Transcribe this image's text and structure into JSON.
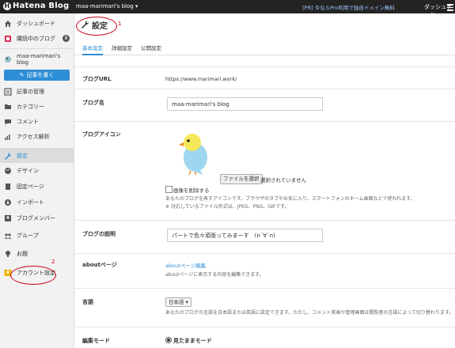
{
  "topbar": {
    "logo_text": "Hatena Blog",
    "blog_selector": "maa-marimari's blog ▾",
    "promo": "[PR] 今ならPro利用で独自ドメイン無料",
    "dashboard": "ダッシュボード"
  },
  "sidebar": {
    "items": [
      {
        "label": "ダッシュボード",
        "icon": "home-icon"
      },
      {
        "label": "購読中のブログ",
        "icon": "rss-icon",
        "badge": "8"
      },
      {
        "label": "maa-marimari's blog",
        "icon": "blog-icon"
      },
      {
        "label": "記事の管理",
        "icon": "list-icon"
      },
      {
        "label": "カテゴリー",
        "icon": "folder-icon"
      },
      {
        "label": "コメント",
        "icon": "comment-icon"
      },
      {
        "label": "アクセス解析",
        "icon": "chart-icon"
      },
      {
        "label": "設定",
        "icon": "wrench-icon"
      },
      {
        "label": "デザイン",
        "icon": "palette-icon"
      },
      {
        "label": "固定ページ",
        "icon": "page-icon"
      },
      {
        "label": "インポート",
        "icon": "import-icon"
      },
      {
        "label": "ブログメンバー",
        "icon": "members-icon"
      },
      {
        "label": "グループ",
        "icon": "group-icon"
      },
      {
        "label": "お題",
        "icon": "bulb-icon"
      },
      {
        "label": "アカウント設定",
        "icon": "account-icon"
      }
    ],
    "write_button": "記事を書く"
  },
  "page": {
    "title": "設定",
    "tabs": [
      "基本設定",
      "詳細設定",
      "公開設定"
    ]
  },
  "form": {
    "blog_url": {
      "label": "ブログURL",
      "value": "https://www.marimari.work/"
    },
    "blog_name": {
      "label": "ブログ名",
      "value": "maa-marimari's blog"
    },
    "blog_icon": {
      "label": "ブログアイコン",
      "file_button": "ファイルを選択",
      "file_status": "選択されていません",
      "delete_checkbox": "画像を削除する",
      "help1": "あなたのブログを表すアイコンです。ブラウザのタブやお気に入り、スマートフォンのホーム画面などで使われます。",
      "help2": "※ 対応しているファイル形式は、JPEG、PNG、GIFです。"
    },
    "blog_description": {
      "label": "ブログの説明",
      "value": "パートで色々頑張ってみまーす　(n´∀`n)"
    },
    "about_page": {
      "label": "aboutページ",
      "link": "aboutページ編集",
      "help": "aboutページに表示する内容を編集できます。"
    },
    "language": {
      "label": "言語",
      "selected": "日本語 ▾",
      "help": "あなたのブログの言語を日本語または英語に設定できます。ただし、コメント実画や管理画面は閲覧者の言語によって切り替わります。"
    },
    "edit_mode": {
      "label": "編集モード",
      "option": "見たままモード"
    }
  },
  "annotations": {
    "num1": "1",
    "num2": "2"
  },
  "colors": {
    "accent": "#2d8dd6",
    "topbar": "#232323",
    "annotation": "#d0021b"
  }
}
